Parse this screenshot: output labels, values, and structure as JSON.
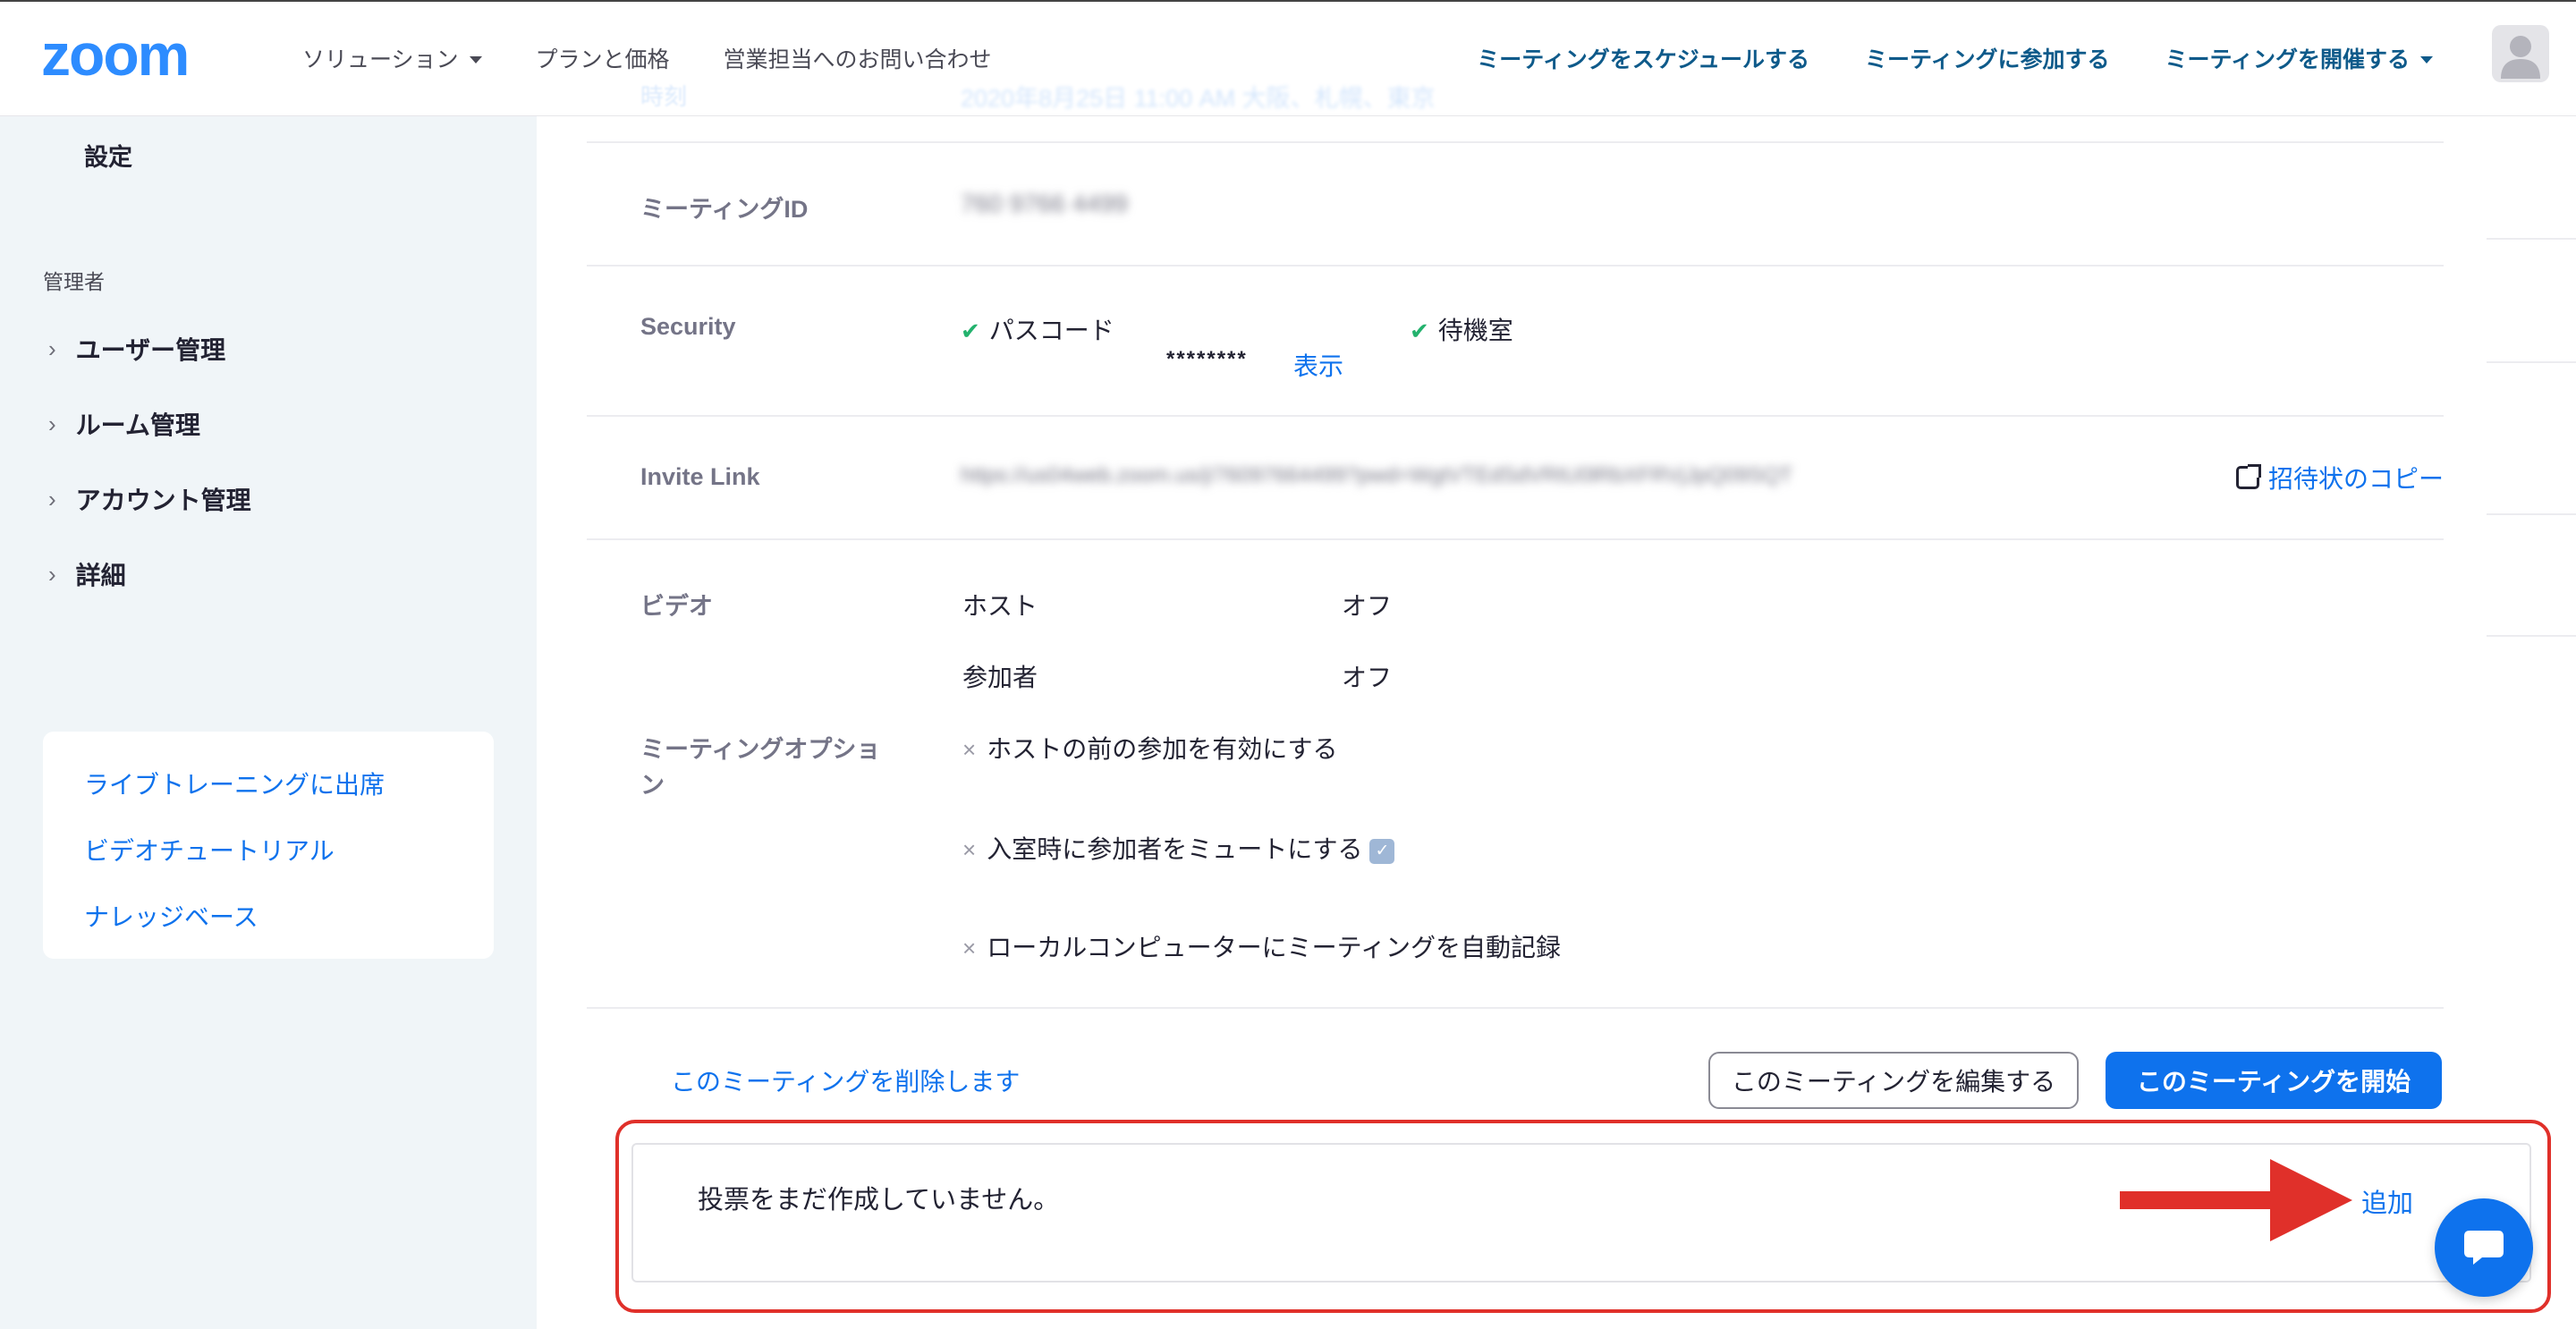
{
  "header": {
    "logo_text": "zoom",
    "nav_left": [
      "ソリューション",
      "プランと価格",
      "営業担当へのお問い合わせ"
    ],
    "nav_right": [
      "ミーティングをスケジュールする",
      "ミーティングに参加する",
      "ミーティングを開催する"
    ]
  },
  "sidebar": {
    "settings": "設定",
    "admin_heading": "管理者",
    "items": [
      "ユーザー管理",
      "ルーム管理",
      "アカウント管理",
      "詳細"
    ],
    "chevron": "›",
    "links": [
      "ライブトレーニングに出席",
      "ビデオチュートリアル",
      "ナレッジベース"
    ]
  },
  "meeting": {
    "faded_label": "時刻",
    "faded_date": "2020年8月25日 11:00 AM 大阪、札幌、東京",
    "id_label": "ミーティングID",
    "id_value": "760 9766 4499",
    "security_label": "Security",
    "passcode_label": "パスコード",
    "passcode_mask": "********",
    "show_link": "表示",
    "waiting_room": "待機室",
    "invite_label": "Invite Link",
    "invite_url": "https://us04web.zoom.us/j/76097664499?pwd=WgtVTEdSdVRtU0lRbXFRVjJpQ09SQT",
    "copy_invite": "招待状のコピー",
    "video_label": "ビデオ",
    "host_label": "ホスト",
    "host_value": "オフ",
    "participant_label": "参加者",
    "participant_value": "オフ",
    "options_label_1": "ミーティングオプショ",
    "options_label_2": "ン",
    "option_1": "ホストの前の参加を有効にする",
    "option_2": "入室時に参加者をミュートにする",
    "option_3": "ローカルコンピューターにミーティングを自動記録",
    "check_mark": "✔",
    "x_mark": "×"
  },
  "actions": {
    "delete": "このミーティングを削除します",
    "edit": "このミーティングを編集する",
    "start": "このミーティングを開始"
  },
  "poll": {
    "empty_text": "投票をまだ作成していません。",
    "add": "追加"
  },
  "colors": {
    "accent": "#0e72ed",
    "highlight_red": "#e0302a",
    "sidebar_bg": "#f0f5f8"
  }
}
